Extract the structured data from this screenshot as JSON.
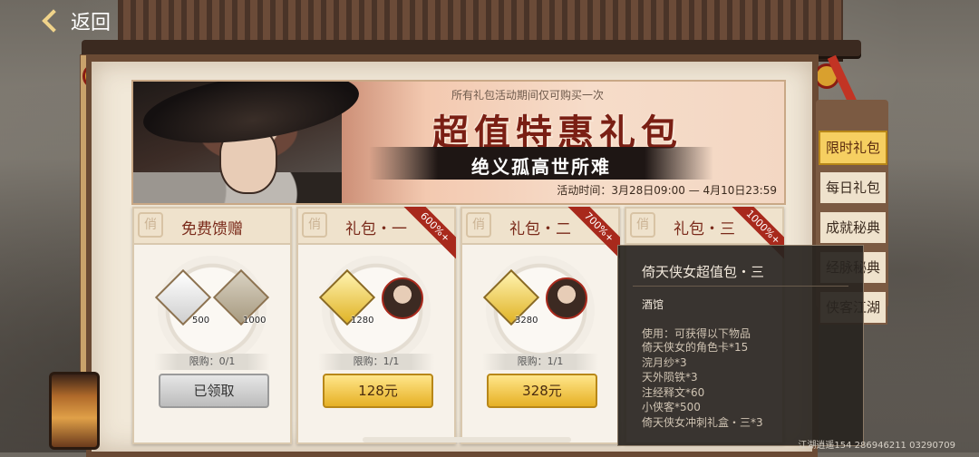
{
  "nav": {
    "back_label": "返回"
  },
  "banner": {
    "note": "所有礼包活动期间仅可购买一次",
    "title": "超值特惠礼包",
    "subtitle": "绝义孤高世所难",
    "event_time_label": "活动时间：",
    "event_time_value": "3月28日09:00 — 4月10日23:59"
  },
  "packs": [
    {
      "title": "免费馈赠",
      "seal": "俏",
      "badge": "",
      "items": [
        {
          "icon": "silver-ingot-icon",
          "qty": "500"
        },
        {
          "icon": "silver-coins-icon",
          "qty": "1000"
        }
      ],
      "limit": "限购：0/1",
      "button": "已领取",
      "button_state": "disabled"
    },
    {
      "title": "礼包・一",
      "seal": "俏",
      "badge": "600%+",
      "items": [
        {
          "icon": "gold-bar-icon",
          "qty": "1280"
        },
        {
          "icon": "hero-portrait-icon",
          "qty": ""
        }
      ],
      "limit": "限购：1/1",
      "button": "128元",
      "button_state": "active"
    },
    {
      "title": "礼包・二",
      "seal": "俏",
      "badge": "700%+",
      "items": [
        {
          "icon": "gold-bar-icon",
          "qty": "3280"
        },
        {
          "icon": "hero-portrait-icon",
          "qty": ""
        }
      ],
      "limit": "限购：1/1",
      "button": "328元",
      "button_state": "active"
    },
    {
      "title": "礼包・三",
      "seal": "俏",
      "badge": "1000%+",
      "items": [],
      "limit": "",
      "button": "",
      "button_state": "hidden"
    }
  ],
  "side_tabs": [
    {
      "label": "限时礼包",
      "active": true
    },
    {
      "label": "每日礼包",
      "active": false
    },
    {
      "label": "成就秘典",
      "active": false
    },
    {
      "label": "经脉秘典",
      "active": false
    },
    {
      "label": "侠客江湖",
      "active": false
    }
  ],
  "tooltip": {
    "title": "倚天侠女超值包・三",
    "category": "酒馆",
    "desc": "使用：可获得以下物品",
    "lines": [
      "倚天侠女的角色卡*15",
      "浣月纱*3",
      "天外陨铁*3",
      "注经释文*60",
      "小侠客*500",
      "倚天侠女冲刺礼盒・三*3"
    ]
  },
  "footer_id": "江湖逍遥154 286946211 03290709",
  "colors": {
    "accent_gold": "#f6cf61",
    "ribbon_red": "#a8291c",
    "title_red": "#7a1f14"
  }
}
